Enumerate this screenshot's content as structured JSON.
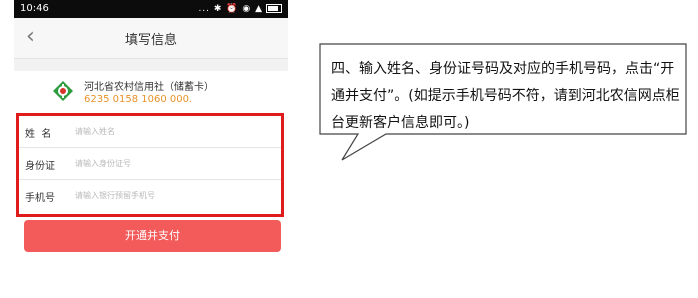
{
  "status_bar": {
    "time": "10:46",
    "icons": "... ✱ ⏰ ◉ ▲"
  },
  "nav": {
    "back_icon": "chevron-left",
    "title": "填写信息"
  },
  "bank": {
    "name": "河北省农村信用社（储蓄卡）",
    "card_number": "6235 0158 1060 000.",
    "logo_color": "#2e9b3e"
  },
  "form": {
    "border_color": "#e01b1b",
    "rows": [
      {
        "label": "姓  名",
        "placeholder": "请输入姓名"
      },
      {
        "label": "身份证",
        "placeholder": "请输入身份证号"
      },
      {
        "label": "手机号",
        "placeholder": "请输入银行预留手机号"
      }
    ]
  },
  "submit": {
    "label": "开通并支付",
    "color": "#f35a5a"
  },
  "callout": {
    "text": "四、输入姓名、身份证号码及对应的手机号码，点击“开通并支付”。(如提示手机号码不符，请到河北农信网点柜台更新客户信息即可。)"
  }
}
